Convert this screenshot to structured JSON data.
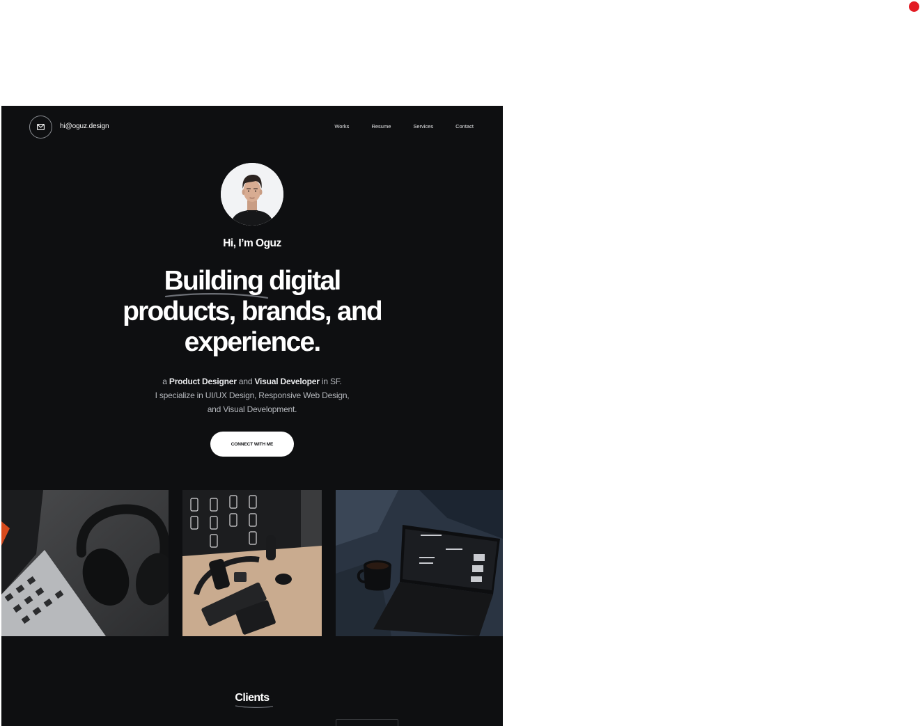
{
  "header": {
    "email": "hi@oguz.design",
    "nav": [
      "Works",
      "Resume",
      "Services",
      "Contact"
    ]
  },
  "hero": {
    "greeting": "Hi, I’m Oguz",
    "headline": [
      "Building digital",
      "products, brands, and",
      "experience."
    ],
    "sub": {
      "line1_a": "a ",
      "role1": "Product Designer",
      "line1_b": " and ",
      "role2": "Visual Developer",
      "line1_c": " in SF.",
      "line2": "I specialize in UI/UX Design, Responsive Web Design,",
      "line3": "and Visual Development."
    },
    "cta_label": "CONNECT WITH ME"
  },
  "gallery": {
    "tiles": [
      "headphones-laptop-photo",
      "desk-setup-photo",
      "laptop-coffee-photo"
    ]
  },
  "clients": {
    "title": "Clients"
  },
  "colors": {
    "page_bg": "#0e0f11",
    "accent_dot": "#e31b23",
    "button_bg": "#ffffff"
  }
}
